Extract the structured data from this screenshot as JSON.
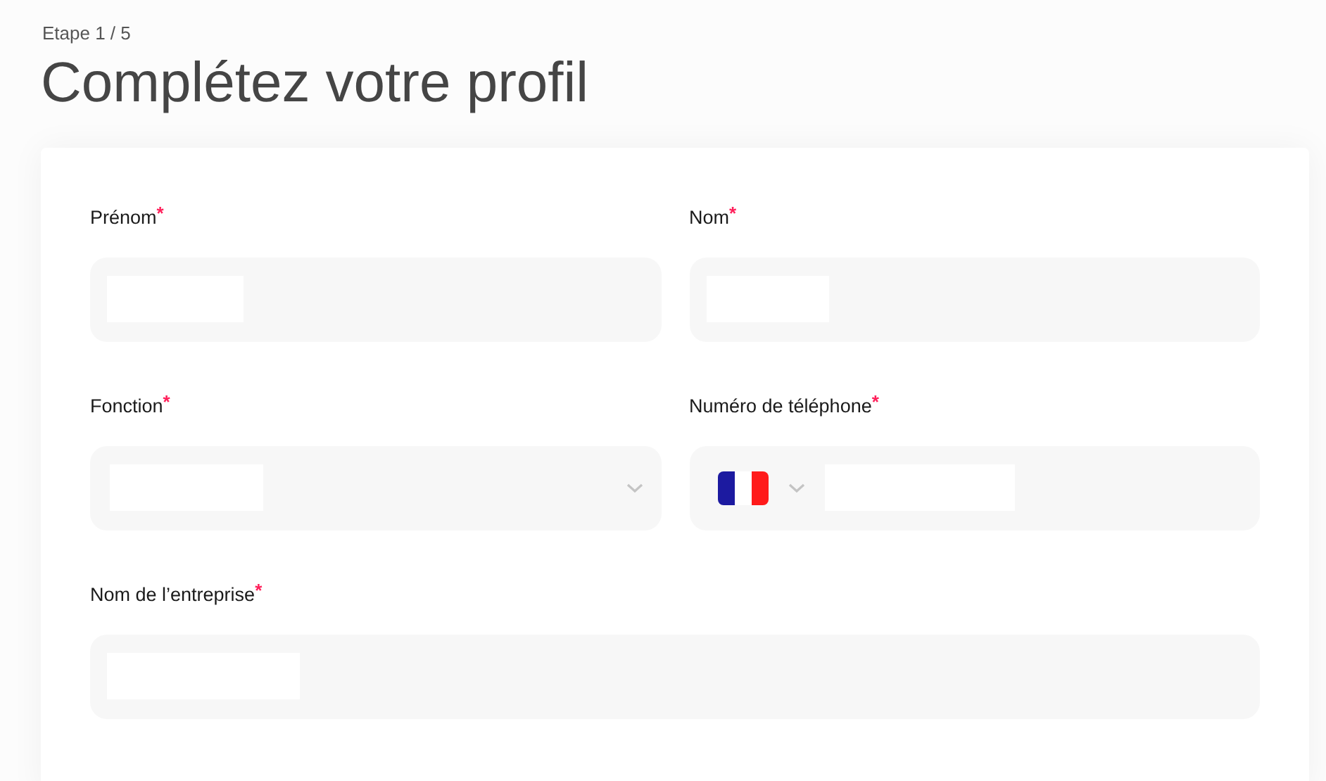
{
  "step": "Etape 1 / 5",
  "title": "Complétez votre profil",
  "fields": [
    {
      "label": "Prénom",
      "marker": "*",
      "kind": "text"
    },
    {
      "label": "Nom",
      "marker": "*",
      "kind": "text"
    },
    {
      "label": "Fonction",
      "marker": "*",
      "kind": "select"
    },
    {
      "label": "Numéro de téléphone",
      "marker": "*",
      "kind": "phone"
    },
    {
      "label": "Nom de l’entreprise",
      "marker": "*",
      "kind": "text",
      "wide": true
    }
  ]
}
